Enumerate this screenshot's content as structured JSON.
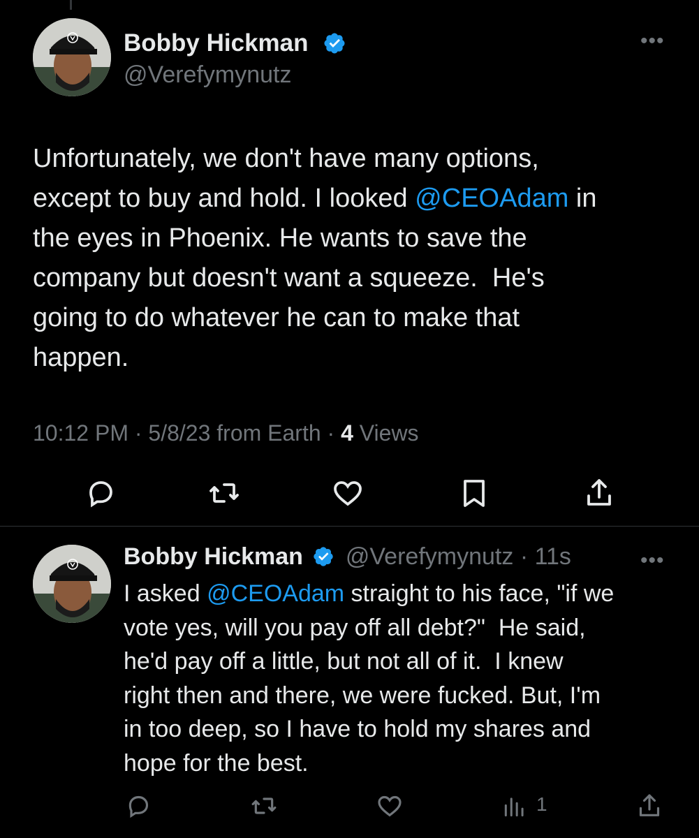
{
  "main_tweet": {
    "author": {
      "name": "Bobby Hickman",
      "handle": "@Verefymynutz",
      "verified": true
    },
    "text_parts": [
      "Unfortunately, we don't have many options,\nexcept to buy and hold. I looked ",
      "@CEOAdam",
      " in\nthe eyes in Phoenix. He wants to save the\ncompany but doesn't want a squeeze.  He's\ngoing to do whatever he can to make that\nhappen."
    ],
    "meta": {
      "time": "10:12 PM",
      "date": "5/8/23",
      "source": "from Earth",
      "views_count": "4",
      "views_label": "Views"
    },
    "actions": [
      "reply-icon",
      "retweet-icon",
      "like-icon",
      "bookmark-icon",
      "share-icon"
    ]
  },
  "reply_tweet": {
    "author": {
      "name": "Bobby Hickman",
      "handle": "@Verefymynutz",
      "verified": true,
      "time_ago": "11s"
    },
    "text_parts": [
      "I asked ",
      "@CEOAdam",
      " straight to his face, \"if we\nvote yes, will you pay off all debt?\"  He said,\nhe'd pay off a little, but not all of it.  I knew\nright then and there, we were fucked. But, I'm\nin too deep, so I have to hold my shares and\nhope for the best."
    ],
    "views_count": "1",
    "actions": [
      "reply-icon",
      "retweet-icon",
      "like-icon",
      "views-icon",
      "share-icon"
    ]
  },
  "colors": {
    "background": "#000000",
    "text": "#e7e9ea",
    "secondary": "#71767b",
    "accent": "#1d9bf0",
    "divider": "#2f3336"
  }
}
